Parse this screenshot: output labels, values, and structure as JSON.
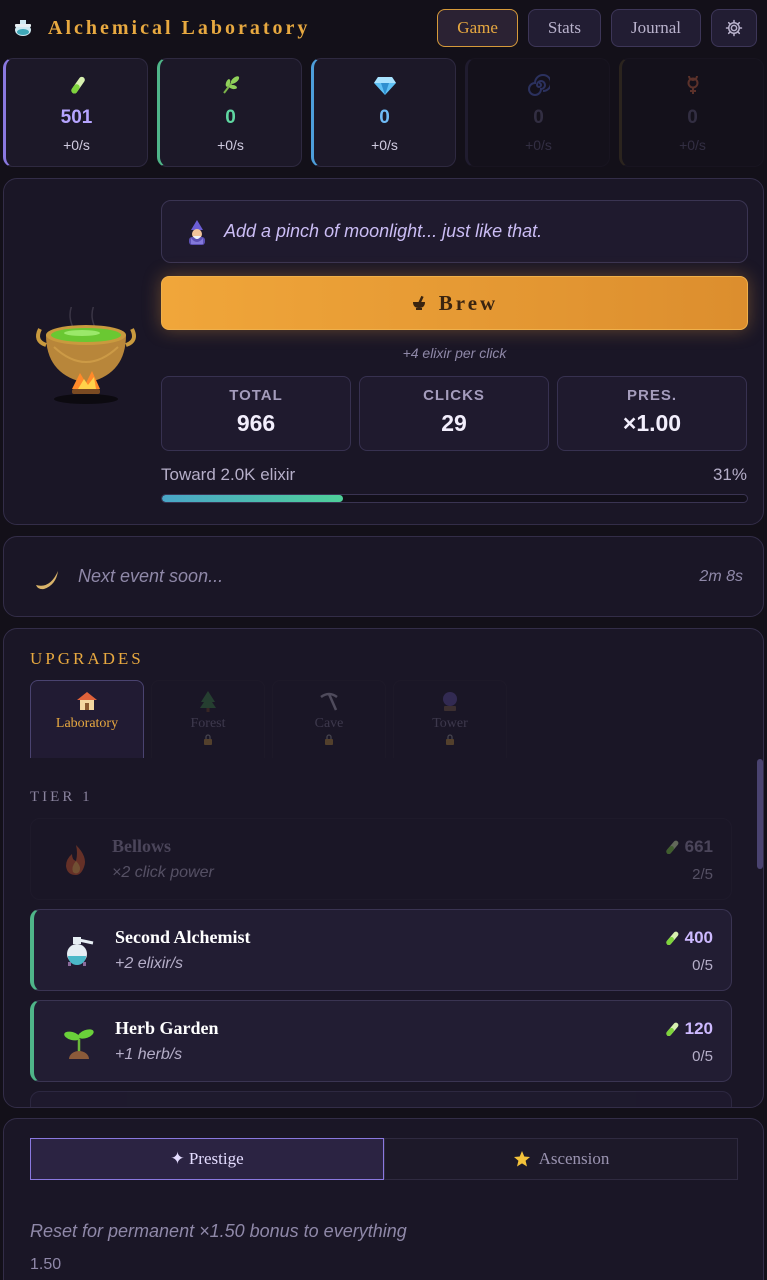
{
  "header": {
    "title": "Alchemical Laboratory",
    "logo_icon": "potion-flask-icon",
    "nav": [
      {
        "label": "Game",
        "active": true
      },
      {
        "label": "Stats",
        "active": false
      },
      {
        "label": "Journal",
        "active": false
      }
    ],
    "settings_icon": "gear-icon"
  },
  "resources": [
    {
      "icon": "test-tube-icon",
      "value": "501",
      "rate": "+0/s",
      "color": "#b6a4ff"
    },
    {
      "icon": "herb-icon",
      "value": "0",
      "rate": "+0/s",
      "color": "#5fd6a1"
    },
    {
      "icon": "gem-icon",
      "value": "0",
      "rate": "+0/s",
      "color": "#6fbaf5"
    },
    {
      "icon": "spiral-icon",
      "value": "0",
      "rate": "+0/s",
      "color": "#6d6690"
    },
    {
      "icon": "mercury-icon",
      "value": "0",
      "rate": "+0/s",
      "color": "#6d6690"
    }
  ],
  "brew": {
    "quote": "Add a pinch of moonlight... just like that.",
    "button_label": "Brew",
    "per_click": "+4 elixir per click",
    "stats": [
      {
        "label": "TOTAL",
        "value": "966"
      },
      {
        "label": "CLICKS",
        "value": "29"
      },
      {
        "label": "PRES.",
        "value": "×1.00"
      }
    ],
    "progress_label": "Toward 2.0K elixir",
    "progress_pct": "31%",
    "progress_value": 0.31
  },
  "event": {
    "text": "Next event soon...",
    "timer": "2m 8s"
  },
  "upgrades": {
    "title": "UPGRADES",
    "tabs": [
      {
        "label": "Laboratory",
        "icon": "house-icon",
        "locked": false
      },
      {
        "label": "Forest",
        "icon": "tree-icon",
        "locked": true
      },
      {
        "label": "Cave",
        "icon": "pickaxe-icon",
        "locked": true
      },
      {
        "label": "Tower",
        "icon": "crystal-ball-icon",
        "locked": true
      }
    ],
    "tier_label": "TIER 1",
    "items": [
      {
        "name": "Bellows",
        "desc": "×2 click power",
        "cost": "661",
        "count": "2/5",
        "icon": "flame-icon",
        "affordable": false
      },
      {
        "name": "Second Alchemist",
        "desc": "+2 elixir/s",
        "cost": "400",
        "count": "0/5",
        "icon": "alembic-icon",
        "affordable": true
      },
      {
        "name": "Herb Garden",
        "desc": "+1 herb/s",
        "cost": "120",
        "count": "0/5",
        "icon": "seedling-icon",
        "affordable": true
      }
    ]
  },
  "prestige": {
    "tabs": [
      {
        "label": "✦ Prestige",
        "active": true
      },
      {
        "label": "Ascension",
        "active": false
      }
    ],
    "desc": "Reset for permanent ×1.50 bonus to everything",
    "value": "1.50"
  }
}
